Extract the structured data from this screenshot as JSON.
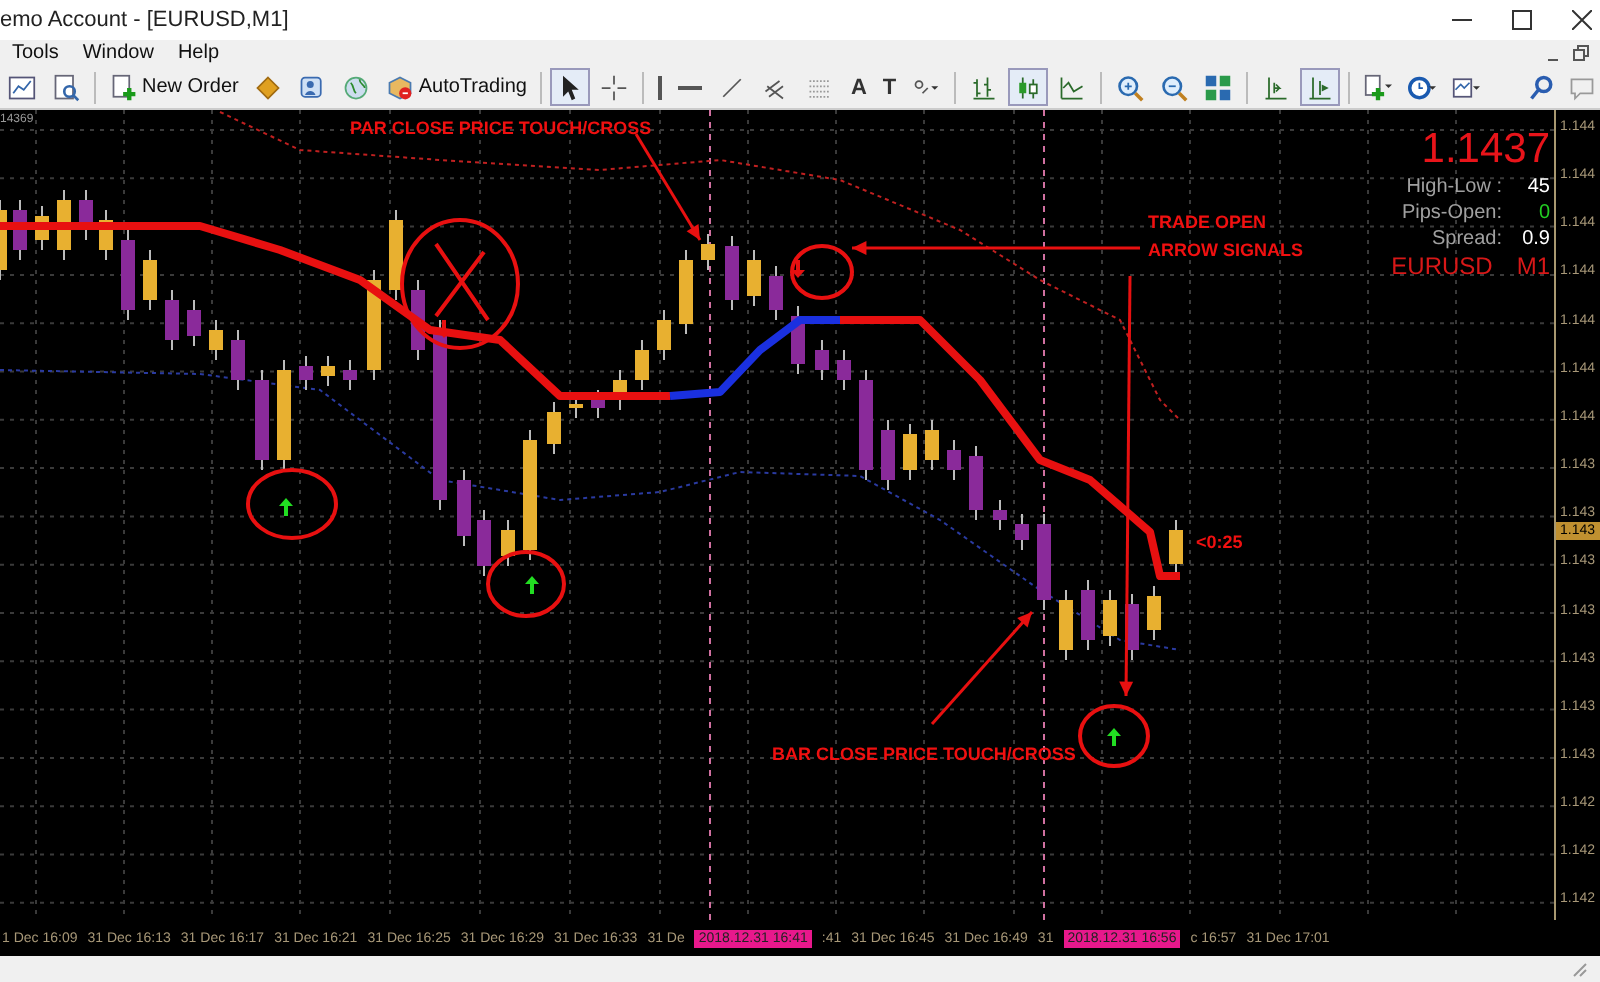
{
  "window": {
    "title": "emo Account - [EURUSD,M1]"
  },
  "menu": [
    {
      "label": "Tools"
    },
    {
      "label": "Window"
    },
    {
      "label": "Help"
    }
  ],
  "toolbar": [
    {
      "pressed": false
    },
    {
      "pressed": false
    },
    {
      "label": "New Order",
      "pressed": false
    },
    {
      "pressed": false
    },
    {
      "pressed": false
    },
    {
      "pressed": false
    },
    {
      "label": "AutoTrading",
      "pressed": false
    },
    {
      "pressed": true
    },
    {
      "pressed": false
    },
    {
      "pressed": false
    },
    {
      "pressed": false
    },
    {
      "pressed": false
    },
    {
      "pressed": false
    },
    {
      "pressed": false
    },
    {
      "label": "A",
      "pressed": false
    },
    {
      "label": "T",
      "pressed": false
    },
    {
      "pressed": false
    },
    {
      "pressed": false
    },
    {
      "pressed": true
    },
    {
      "pressed": false
    },
    {
      "pressed": false
    },
    {
      "pressed": false
    },
    {
      "pressed": false
    },
    {
      "pressed": false
    },
    {
      "pressed": true
    },
    {
      "pressed": false
    },
    {
      "pressed": false
    },
    {
      "pressed": false
    }
  ],
  "chart": {
    "corner_label": "14369",
    "info_panel": {
      "price": "1.1437",
      "rows": [
        {
          "label": "High-Low :",
          "value": "45",
          "color": "#ffffff"
        },
        {
          "label": "Pips-Open:",
          "value": "0",
          "color": "#22cc22"
        },
        {
          "label": "Spread:",
          "value": "0.9",
          "color": "#ffffff"
        }
      ],
      "symbol": "EURUSD",
      "timeframe": "M1"
    },
    "annotations": [
      {
        "kind": "caption",
        "text": "PAR CLOSE PRICE TOUCH/CROSS"
      },
      {
        "kind": "caption",
        "text": "TRADE OPEN ARROW SIGNALS"
      },
      {
        "kind": "caption",
        "text": "BAR CLOSE PRICE TOUCH/CROSS"
      },
      {
        "kind": "countdown",
        "text": "<0:25"
      }
    ],
    "price_axis": {
      "labels": [
        "1.144",
        "1.144",
        "1.144",
        "1.144",
        "1.144",
        "1.144",
        "1.144",
        "1.143",
        "1.143",
        "1.143",
        "1.143",
        "1.143",
        "1.143",
        "1.143",
        "1.142",
        "1.142",
        "1.142"
      ],
      "current": "1.143"
    },
    "time_axis": [
      {
        "text": "1 Dec 16:09",
        "highlight": false
      },
      {
        "text": "31 Dec 16:13",
        "highlight": false
      },
      {
        "text": "31 Dec 16:17",
        "highlight": false
      },
      {
        "text": "31 Dec 16:21",
        "highlight": false
      },
      {
        "text": "31 Dec 16:25",
        "highlight": false
      },
      {
        "text": "31 Dec 16:29",
        "highlight": false
      },
      {
        "text": "31 Dec 16:33",
        "highlight": false
      },
      {
        "text": "31 De",
        "highlight": false
      },
      {
        "text": "2018.12.31 16:41",
        "highlight": true
      },
      {
        "text": ":41",
        "highlight": false
      },
      {
        "text": "31 Dec 16:45",
        "highlight": false
      },
      {
        "text": "31 Dec 16:49",
        "highlight": false
      },
      {
        "text": "31",
        "highlight": false
      },
      {
        "text": "2018.12.31 16:56",
        "highlight": true
      },
      {
        "text": "c 16:57",
        "highlight": false
      },
      {
        "text": "31 Dec 17:01",
        "highlight": false
      }
    ]
  }
}
